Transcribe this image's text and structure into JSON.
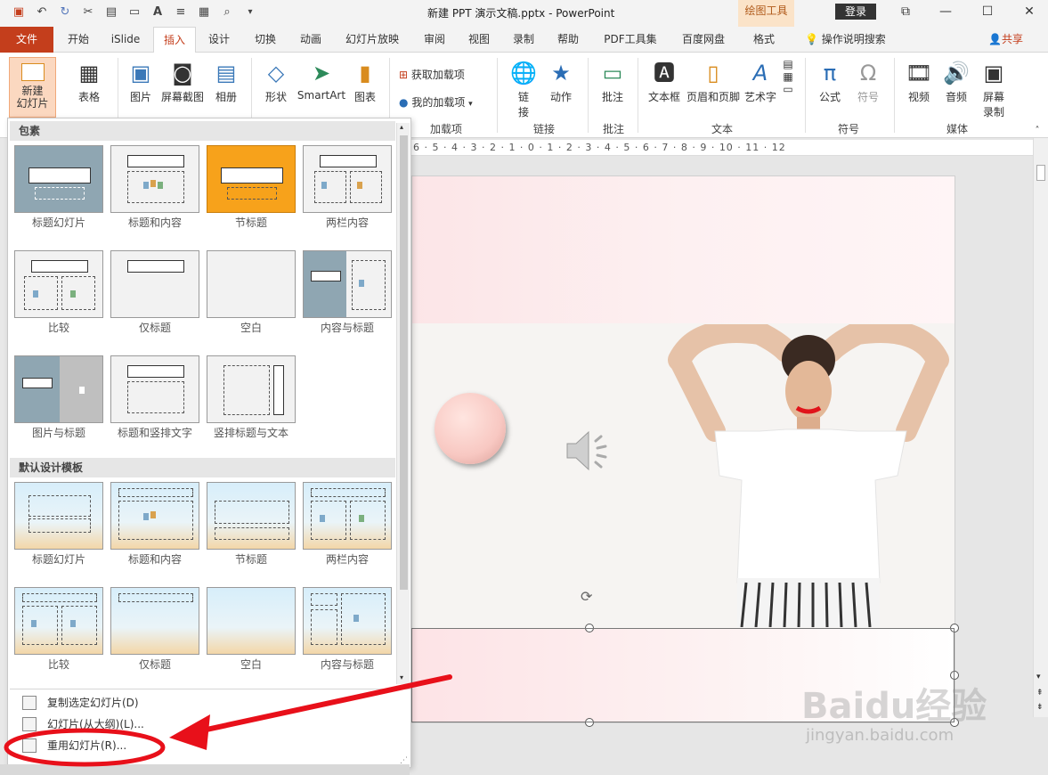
{
  "window": {
    "title": "新建 PPT 演示文稿.pptx - PowerPoint",
    "context_tab": "绘图工具",
    "login": "登录"
  },
  "tabs": [
    "文件",
    "开始",
    "iSlide",
    "插入",
    "设计",
    "切换",
    "动画",
    "幻灯片放映",
    "审阅",
    "视图",
    "录制",
    "帮助",
    "PDF工具集",
    "百度网盘",
    "格式"
  ],
  "help_search": "操作说明搜索",
  "share": "共享",
  "ribbon": {
    "new_slide": "新建\n幻灯片",
    "table": "表格",
    "picture": "图片",
    "screenshot": "屏幕截图",
    "album": "相册",
    "shape": "形状",
    "smartart": "SmartArt",
    "chart": "图表",
    "get_addins": "获取加载项",
    "my_addins": "我的加载项",
    "link": "链\n接",
    "action": "动作",
    "comment": "批注",
    "textbox": "文本框",
    "header_footer": "页眉和页脚",
    "wordart": "艺术字",
    "equation": "公式",
    "symbol": "符号",
    "video": "视频",
    "audio": "音频",
    "screen_record": "屏幕\n录制",
    "groups": [
      "加载项",
      "链接",
      "批注",
      "文本",
      "符号",
      "媒体"
    ]
  },
  "ruler": "6 · 5 · 4 · 3 · 2 · 1 · 0 · 1 · 2 · 3 · 4 · 5 · 6 · 7 · 8 · 9 · 10 · 11 · 12",
  "panel": {
    "section1": "包素",
    "section2": "默认设计模板",
    "layouts1": [
      "标题幻灯片",
      "标题和内容",
      "节标题",
      "两栏内容",
      "比较",
      "仅标题",
      "空白",
      "内容与标题",
      "图片与标题",
      "标题和竖排文字",
      "竖排标题与文本"
    ],
    "layouts2": [
      "标题幻灯片",
      "标题和内容",
      "节标题",
      "两栏内容",
      "比较",
      "仅标题",
      "空白",
      "内容与标题"
    ],
    "commands": [
      "复制选定幻灯片(D)",
      "幻灯片(从大纲)(L)...",
      "重用幻灯片(R)..."
    ]
  },
  "watermark": "Baidu经验",
  "watermark_sub": "jingyan.baidu.com",
  "colors": {
    "accent": "#c43e1c",
    "annotation": "#e8101a"
  }
}
